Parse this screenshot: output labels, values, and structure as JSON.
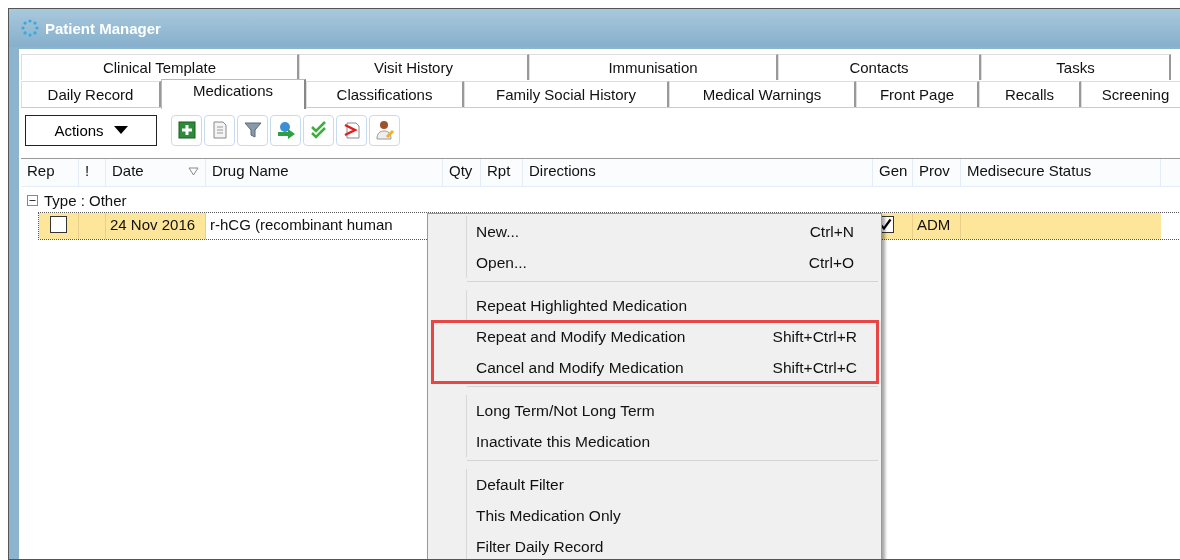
{
  "window": {
    "title": "Patient Manager"
  },
  "tab_rows": [
    [
      {
        "label": "Clinical Template",
        "selected": false
      },
      {
        "label": "Visit History",
        "selected": false
      },
      {
        "label": "Immunisation",
        "selected": false
      },
      {
        "label": "Contacts",
        "selected": false
      },
      {
        "label": "Tasks",
        "selected": false
      }
    ],
    [
      {
        "label": "Daily Record",
        "selected": false
      },
      {
        "label": "Medications",
        "selected": true
      },
      {
        "label": "Classifications",
        "selected": false
      },
      {
        "label": "Family Social History",
        "selected": false
      },
      {
        "label": "Medical Warnings",
        "selected": false
      },
      {
        "label": "Front Page",
        "selected": false
      },
      {
        "label": "Recalls",
        "selected": false
      },
      {
        "label": "Screening",
        "selected": false
      }
    ]
  ],
  "toolbar": {
    "actions_button": "Actions",
    "tools": [
      {
        "kind": "add"
      },
      {
        "kind": "document"
      },
      {
        "kind": "filter"
      },
      {
        "kind": "long-term"
      },
      {
        "kind": "check"
      },
      {
        "kind": "cancel"
      },
      {
        "kind": "doctor"
      }
    ]
  },
  "table": {
    "columns": [
      {
        "label": "Rep"
      },
      {
        "label": "!"
      },
      {
        "label": "Date",
        "sorted": true
      },
      {
        "label": "Drug Name"
      },
      {
        "label": "Qty"
      },
      {
        "label": "Rpt"
      },
      {
        "label": "Directions"
      },
      {
        "label": "Gen"
      },
      {
        "label": "Prov"
      },
      {
        "label": "Medisecure Status"
      }
    ],
    "groups": [
      {
        "label": "Type : Other",
        "expanded": true,
        "rows": [
          {
            "selected": true,
            "rep_checked": false,
            "date": "24 Nov 2016",
            "drug_name": "r-hCG (recombinant human",
            "gen_checked": true,
            "prov": "ADM"
          }
        ]
      }
    ]
  },
  "context_menu": {
    "sections": [
      {
        "items": [
          {
            "label": "New...",
            "shortcut": "Ctrl+N",
            "highlighted": false
          },
          {
            "label": "Open...",
            "shortcut": "Ctrl+O",
            "highlighted": false
          }
        ]
      },
      {
        "items": [
          {
            "label": "Repeat Highlighted Medication",
            "highlighted": false
          },
          {
            "label": "Repeat and Modify Medication",
            "shortcut": "Shift+Ctrl+R",
            "highlighted": true
          },
          {
            "label": "Cancel and Modify Medication",
            "shortcut": "Shift+Ctrl+C",
            "highlighted": true
          }
        ]
      },
      {
        "items": [
          {
            "label": "Long Term/Not Long Term",
            "highlighted": false
          },
          {
            "label": "Inactivate this Medication",
            "highlighted": false
          }
        ]
      },
      {
        "items": [
          {
            "label": "Default Filter",
            "highlighted": false
          },
          {
            "label": "This Medication Only",
            "highlighted": false
          },
          {
            "label": "Filter Daily Record",
            "highlighted": false
          }
        ]
      }
    ]
  }
}
